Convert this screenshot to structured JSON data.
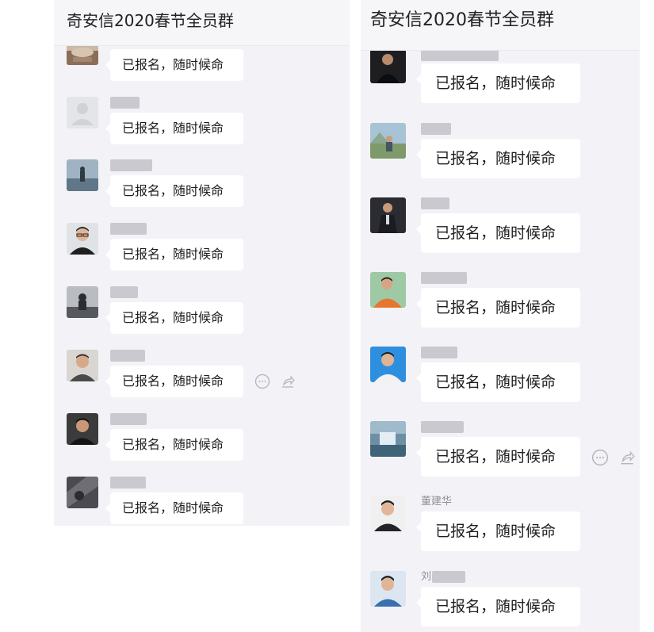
{
  "left_panel": {
    "title": "奇安信2020春节全员群",
    "messages": [
      {
        "sender": "",
        "text": "已报名，随时候命",
        "avatar": "landscape-photo"
      },
      {
        "sender": "",
        "text": "已报名，随时候命",
        "avatar": "default-avatar"
      },
      {
        "sender": "",
        "text": "已报名，随时候命",
        "avatar": "seaside-photo"
      },
      {
        "sender": "",
        "text": "已报名，随时候命",
        "avatar": "man-with-glasses-photo"
      },
      {
        "sender": "",
        "text": "已报名，随时候命",
        "avatar": "silhouette-photo"
      },
      {
        "sender": "",
        "text": "已报名，随时候命",
        "avatar": "man-portrait-photo"
      },
      {
        "sender": "",
        "text": "已报名，随时候命",
        "avatar": "man-dark-photo"
      },
      {
        "sender": "",
        "text": "已报名，随时候命",
        "avatar": "dark-abstract-photo"
      }
    ],
    "actions": {
      "comment_icon": "comment-icon",
      "share_icon": "share-icon"
    }
  },
  "right_panel": {
    "title": "奇安信2020春节全员群",
    "messages": [
      {
        "sender": "",
        "text": "已报名，随时候命",
        "avatar": "man-dark-suit-photo"
      },
      {
        "sender": "",
        "text": "已报名，随时候命",
        "avatar": "outdoor-photo"
      },
      {
        "sender": "",
        "text": "已报名，随时候命",
        "avatar": "man-suit-photo"
      },
      {
        "sender": "",
        "text": "已报名，随时候命",
        "avatar": "orange-shirt-photo"
      },
      {
        "sender": "",
        "text": "已报名，随时候命",
        "avatar": "id-photo-blue"
      },
      {
        "sender": "",
        "text": "已报名，随时候命",
        "avatar": "waterfall-photo"
      },
      {
        "sender": "董建华",
        "text": "已报名，随时候命",
        "avatar": "young-man-photo"
      },
      {
        "sender": "刘",
        "text": "已报名，随时候命",
        "avatar": "id-photo-young-man"
      }
    ],
    "actions": {
      "comment_icon": "comment-icon",
      "share_icon": "share-icon"
    }
  },
  "colors": {
    "chat_background": "#f3f2f7",
    "bubble": "#ffffff",
    "header": "#f6f6f9"
  }
}
